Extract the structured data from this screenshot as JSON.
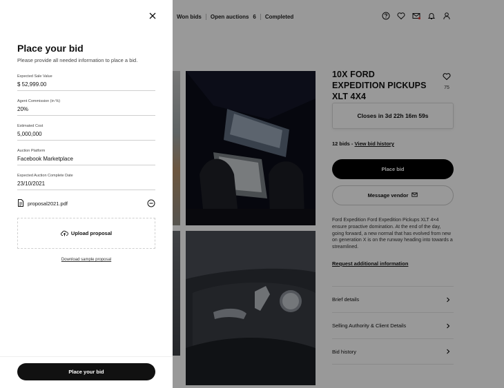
{
  "nav": {
    "won_bids": "Won bids",
    "open_auctions": "Open auctions",
    "open_auctions_count": "6",
    "completed": "Completed",
    "icons": [
      "help-icon",
      "heart-icon",
      "mail-icon",
      "bell-icon",
      "user-icon"
    ]
  },
  "listing": {
    "title": "10X FORD EXPEDITION PICKUPS XLT 4X4",
    "favorite_count": "75",
    "closes_text": "Closes in 3d 22h 16m 59s",
    "bids_count_text": "12 bids - ",
    "bid_history_link": "View bid history",
    "place_bid_label": "Place bid",
    "message_vendor_label": "Message vendor",
    "description": "Ford Expedition Ford Expedition Pickups XLT 4×4 ensure proactive domination. At the end of the day, going forward, a new normal that has evolved from new on generation X is on the runway heading into towards a streamlined.",
    "request_info_link": "Request additional information",
    "accordion": [
      {
        "label": "Brief details"
      },
      {
        "label": "Selling Authority & Client Details"
      },
      {
        "label": "Bid history"
      }
    ]
  },
  "drawer": {
    "title": "Place your bid",
    "subtitle": "Please provide all needed information to place a bid.",
    "fields": [
      {
        "label": "Expected Sale Value",
        "value": "$ 52,999.00"
      },
      {
        "label": "Agent Commission (in %)",
        "value": "20%"
      },
      {
        "label": "Estimated Cost",
        "value": "5,000,000"
      },
      {
        "label": "Auction Platform",
        "value": "Facebook Marketplace"
      },
      {
        "label": "Expected Auction Complete Date",
        "value": "23/10/2021"
      }
    ],
    "attached_file": "proposal2021.pdf",
    "upload_label": "Upload proposal",
    "sample_link": "Download sample proposal",
    "submit_label": "Place your bid"
  },
  "colors": {
    "primary_button": "#111111",
    "overlay": "rgba(0,0,0,0.4)"
  }
}
